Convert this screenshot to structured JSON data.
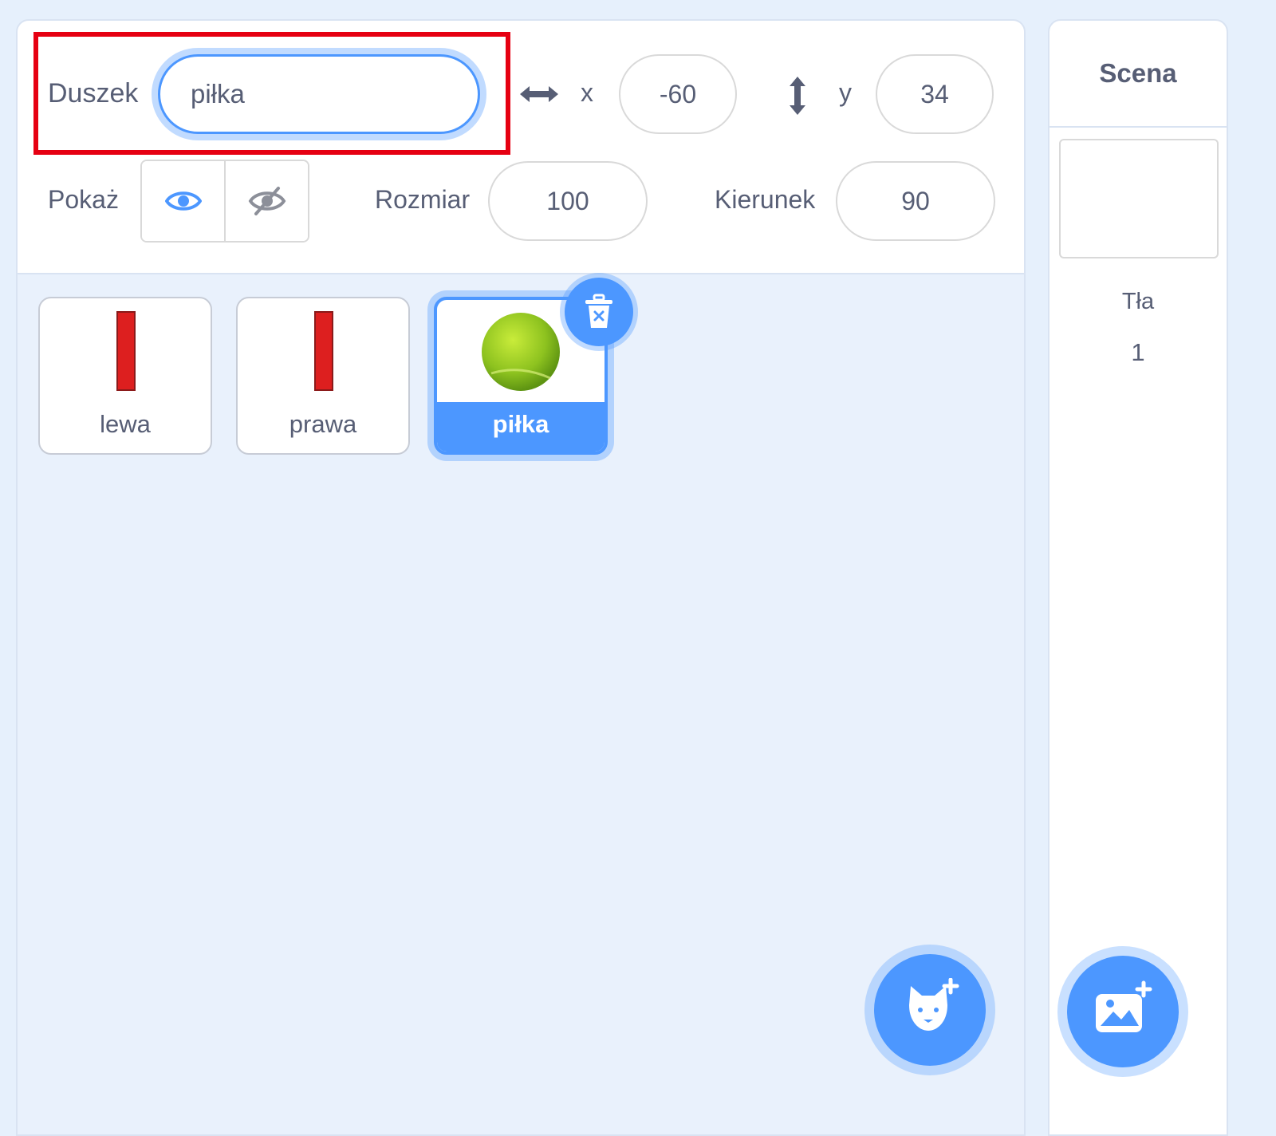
{
  "sprite_info": {
    "name_label": "Duszek",
    "name_value": "piłka",
    "x_label": "x",
    "x_value": "-60",
    "y_label": "y",
    "y_value": "34",
    "show_label": "Pokaż",
    "size_label": "Rozmiar",
    "size_value": "100",
    "direction_label": "Kierunek",
    "direction_value": "90"
  },
  "sprites": [
    {
      "name": "lewa",
      "selected": false,
      "icon": "red-paddle"
    },
    {
      "name": "prawa",
      "selected": false,
      "icon": "red-paddle"
    },
    {
      "name": "piłka",
      "selected": true,
      "icon": "tennis-ball"
    }
  ],
  "stage": {
    "title": "Scena",
    "backdrops_label": "Tła",
    "backdrops_count": "1"
  },
  "icons": {
    "x_axis": "horizontal-arrow-icon",
    "y_axis": "vertical-arrow-icon",
    "show": "eye-icon",
    "hide": "eye-slash-icon",
    "delete": "trash-icon",
    "add_sprite": "cat-plus-icon",
    "add_backdrop": "image-plus-icon"
  },
  "colors": {
    "accent": "#4c97ff",
    "text": "#575e75",
    "highlight": "#e60012",
    "paddle": "#dd1f1f",
    "ball": "#a6d11b"
  }
}
